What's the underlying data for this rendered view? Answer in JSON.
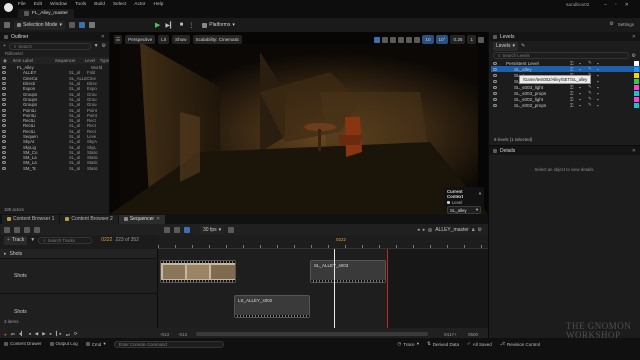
{
  "title_bar": {
    "project": "FL_Alley_master",
    "window_name": "sandbox02",
    "menu": [
      "File",
      "Edit",
      "Window",
      "Tools",
      "Build",
      "Select",
      "Actor",
      "Help"
    ]
  },
  "toolbar": {
    "selection_mode": "Selection Mode",
    "platforms": "Platforms"
  },
  "outliner": {
    "tab": "Outliner",
    "search_placeholder": "Search",
    "breadcrumb": "Rdlevelel",
    "columns": {
      "label": "Item Label",
      "sequencer": "Sequencer",
      "level": "Level",
      "type": "Type"
    },
    "rows": [
      {
        "label": "FL_Alley",
        "level": "",
        "type": "World"
      },
      {
        "label": "ALLEY",
        "level": "SL_al",
        "type": "Fold"
      },
      {
        "label": "CineCa",
        "level": "SL_ALLEY_s002",
        "type": "Cine"
      },
      {
        "label": "Directi",
        "level": "SL_al",
        "type": "Direc"
      },
      {
        "label": "Expon",
        "level": "SL_al",
        "type": "Expo"
      },
      {
        "label": "Groups",
        "level": "SL_al",
        "type": "Grou"
      },
      {
        "label": "Groups",
        "level": "SL_al",
        "type": "Grou"
      },
      {
        "label": "Groups",
        "level": "SL_al",
        "type": "Grou"
      },
      {
        "label": "PointLi",
        "level": "SL_al",
        "type": "Point"
      },
      {
        "label": "PointLi",
        "level": "SL_al",
        "type": "Point"
      },
      {
        "label": "RectLi",
        "level": "SL_al",
        "type": "Rect"
      },
      {
        "label": "RectLi",
        "level": "SL_al",
        "type": "Rect"
      },
      {
        "label": "RectLi",
        "level": "SL_al",
        "type": "Rect"
      },
      {
        "label": "Sequen",
        "level": "SL_al",
        "type": "Leve"
      },
      {
        "label": "SkyAt",
        "level": "SL_al",
        "type": "SkyA"
      },
      {
        "label": "SkyLig",
        "level": "SL_al",
        "type": "SkyL"
      },
      {
        "label": "SM_Co",
        "level": "SL_al",
        "type": "Static"
      },
      {
        "label": "SM_La",
        "level": "SL_al",
        "type": "Static"
      },
      {
        "label": "SM_La",
        "level": "SL_al",
        "type": "Static"
      },
      {
        "label": "SM_Tc",
        "level": "SL_al",
        "type": "Static"
      }
    ],
    "footer": "189 actors"
  },
  "viewport": {
    "perspective": "Perspective",
    "lit": "Lit",
    "show": "Show",
    "scalability": "Scalability: Cinematic",
    "grid_snap": "10",
    "rot_snap": "10°",
    "scale_snap": "0.25",
    "camera_speed": "1",
    "current_context_label": "Current Context",
    "level_label": "Level",
    "level_value": "SL_alley"
  },
  "levels": {
    "tab": "Levels",
    "dropdown": "Levels",
    "search_placeholder": "Search Levels",
    "columns": {
      "name": "Persistent Level"
    },
    "rows": [
      {
        "name": "Persistent Level",
        "color": "#ffffff"
      },
      {
        "name": "SL_alley",
        "color": "#1e90ff"
      },
      {
        "name": "SL_a",
        "color": "#ffd200"
      },
      {
        "name": "SL_a",
        "color": "#2ecc40"
      },
      {
        "name": "SL_s003_light",
        "color": "#ff3fdc"
      },
      {
        "name": "SL_s003_props",
        "color": "#17c2c9"
      },
      {
        "name": "SL_s002_light",
        "color": "#ff3fdc"
      },
      {
        "name": "SL_s002_props",
        "color": "#17c2c9"
      }
    ],
    "tooltip": "/Game/test002/Alley/SET/SL_alley",
    "footer": "8 levels (1 selected)"
  },
  "details": {
    "tab": "Details",
    "search_placeholder": "Select an object to view details."
  },
  "bottom_tabs": [
    "Content Browser 1",
    "Content Browser 2",
    "Sequencer"
  ],
  "sequencer": {
    "fps": "30 fps",
    "sequence_name": "ALLEY_master",
    "track_button": "Track",
    "search_placeholder": "Search Tracks",
    "current_frame": "0222",
    "frame_of": "223 of 352",
    "playhead_label": "0222",
    "tracks": [
      "Shots",
      "Shots",
      "Shots"
    ],
    "clips": [
      "SL_ALLEY_s003",
      "LS_ALLEY_s002"
    ],
    "range_start": "-013",
    "range_start2": "-013",
    "range_end": "0417+",
    "range_end2": "0500",
    "items_footer": "3 items"
  },
  "status_bar": {
    "content_drawer": "Content Drawer",
    "output_log": "Output Log",
    "cmd": "Cmd",
    "console_placeholder": "Enter Console Command",
    "trace": "Trace",
    "derived_data": "Derived Data",
    "all_saved": "All Saved",
    "revision_control": "Revision Control"
  },
  "watermark": {
    "line1": "THE GNOMON",
    "line2": "WORKSHOP"
  }
}
